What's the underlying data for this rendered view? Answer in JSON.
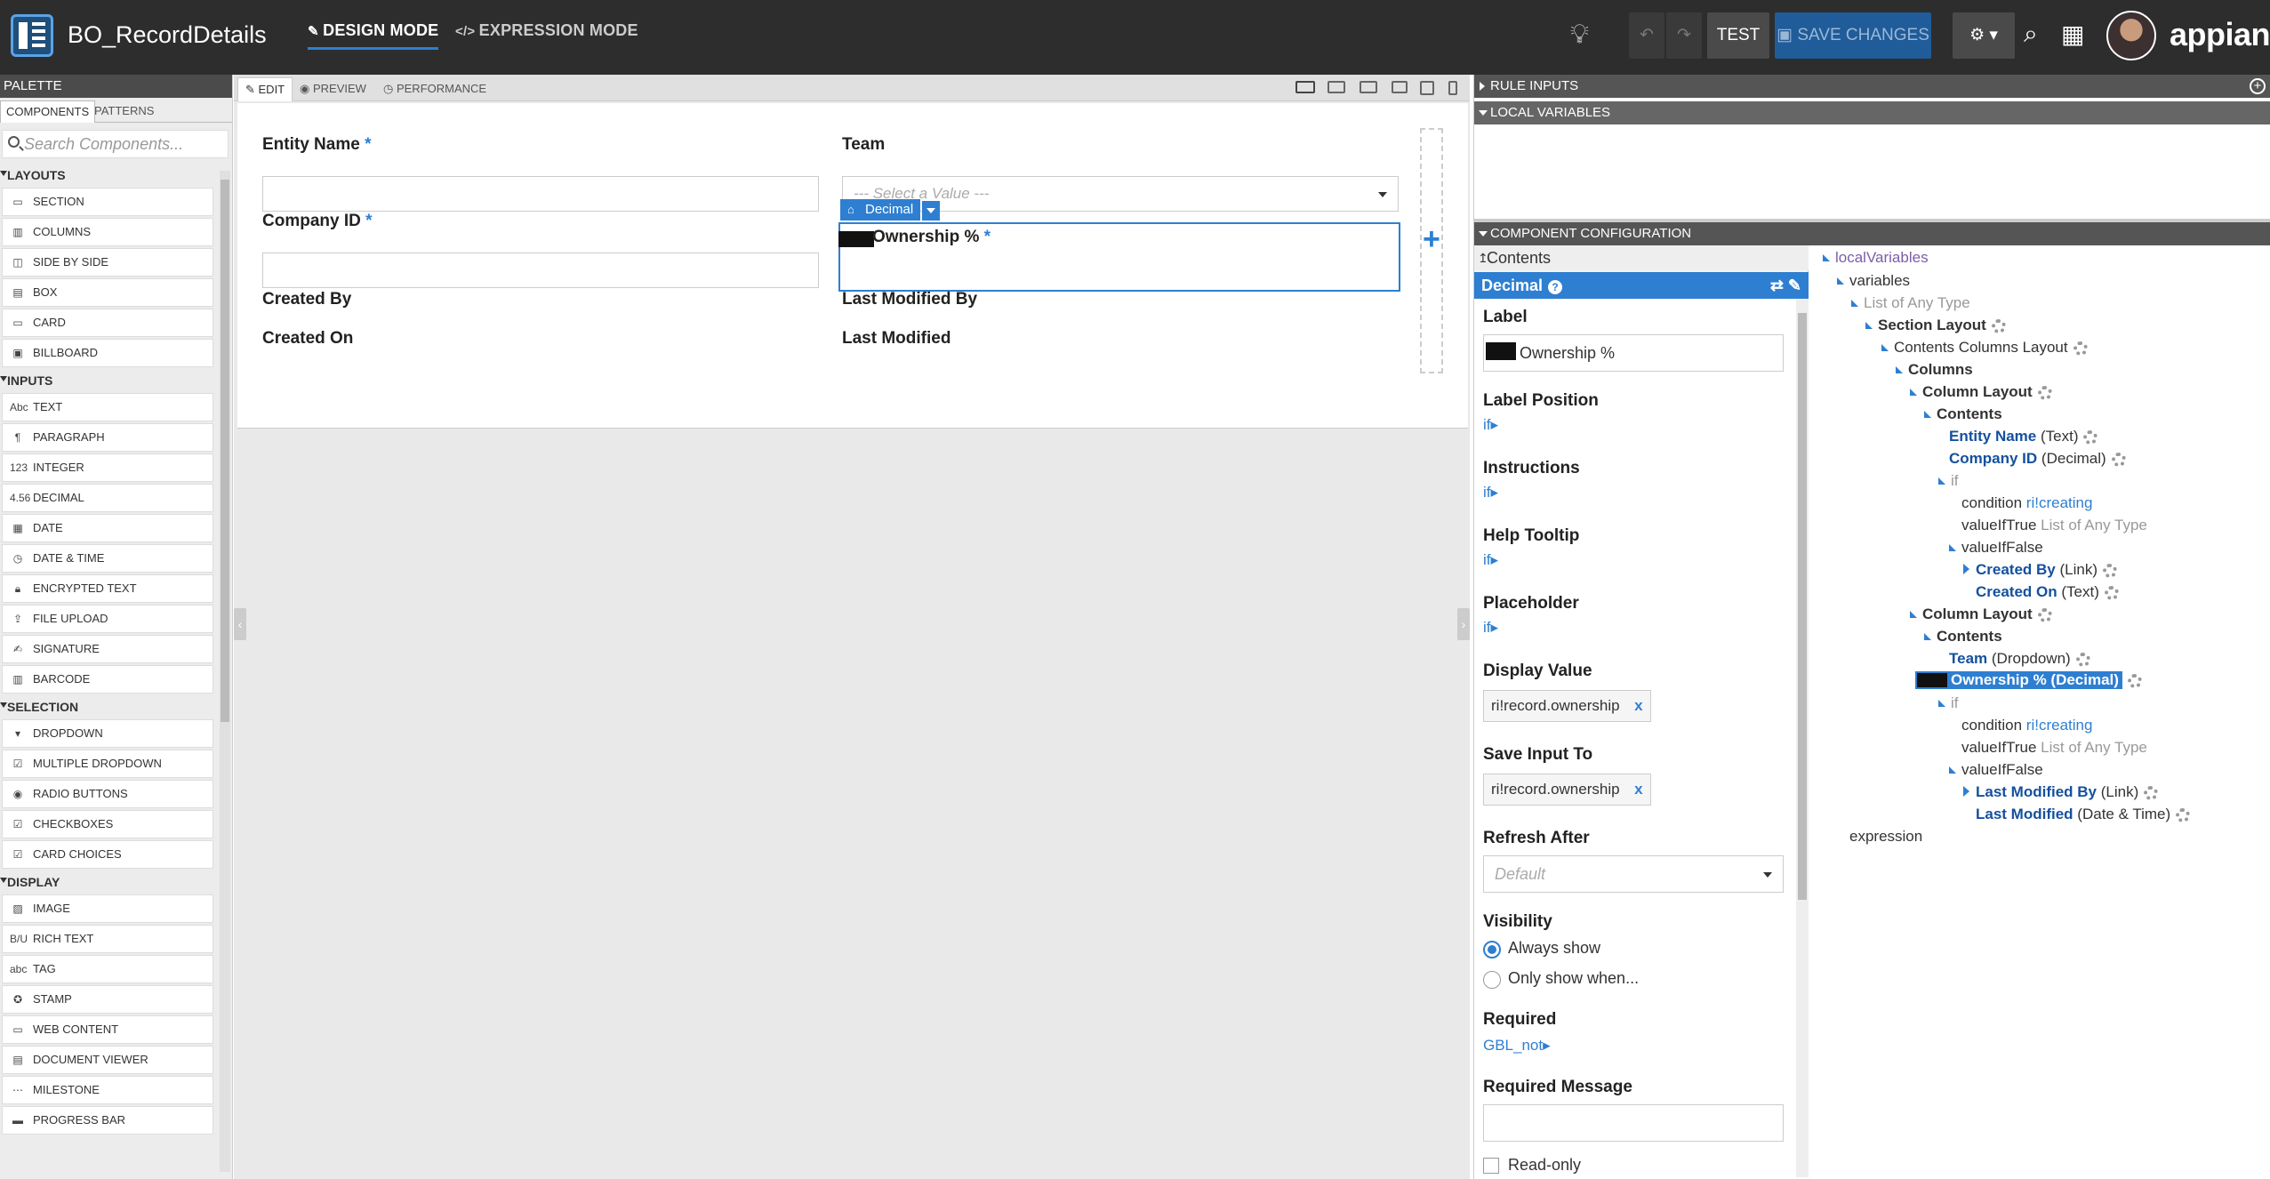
{
  "topbar": {
    "title": "BO_RecordDetails",
    "design_mode": "DESIGN MODE",
    "expression_mode": "EXPRESSION MODE",
    "test_label": "TEST",
    "save_label": "SAVE CHANGES",
    "brand": "appian"
  },
  "palette": {
    "header": "PALETTE",
    "tab_components": "COMPONENTS",
    "tab_patterns": "PATTERNS",
    "search_placeholder": "Search Components...",
    "categories": [
      {
        "name": "LAYOUTS",
        "items": [
          "SECTION",
          "COLUMNS",
          "SIDE BY SIDE",
          "BOX",
          "CARD",
          "BILLBOARD"
        ]
      },
      {
        "name": "INPUTS",
        "items": [
          "TEXT",
          "PARAGRAPH",
          "INTEGER",
          "DECIMAL",
          "DATE",
          "DATE & TIME",
          "ENCRYPTED TEXT",
          "FILE UPLOAD",
          "SIGNATURE",
          "BARCODE"
        ]
      },
      {
        "name": "SELECTION",
        "items": [
          "DROPDOWN",
          "MULTIPLE DROPDOWN",
          "RADIO BUTTONS",
          "CHECKBOXES",
          "CARD CHOICES"
        ]
      },
      {
        "name": "DISPLAY",
        "items": [
          "IMAGE",
          "RICH TEXT",
          "TAG",
          "STAMP",
          "WEB CONTENT",
          "DOCUMENT VIEWER",
          "MILESTONE",
          "PROGRESS BAR"
        ]
      }
    ]
  },
  "editor": {
    "tab_edit": "EDIT",
    "tab_preview": "PREVIEW",
    "tab_performance": "PERFORMANCE",
    "form": {
      "entity_name": "Entity Name",
      "team": "Team",
      "team_placeholder": "--- Select a Value ---",
      "company_id": "Company ID",
      "ownership": "Ownership %",
      "created_by": "Created By",
      "last_modified_by": "Last Modified By",
      "created_on": "Created On",
      "last_modified": "Last Modified",
      "required_mark": "*",
      "selected_tag": "Decimal",
      "add_column": "+"
    }
  },
  "right_panel": {
    "rule_inputs": "RULE INPUTS",
    "local_variables": "LOCAL VARIABLES",
    "component_configuration": "COMPONENT CONFIGURATION",
    "crumb": "Contents",
    "component_name": "Decimal",
    "config": {
      "label_title": "Label",
      "label_value": "Ownership %",
      "label_position": "Label Position",
      "instructions": "Instructions",
      "help_tooltip": "Help Tooltip",
      "placeholder": "Placeholder",
      "if_link": "if",
      "display_value": "Display Value",
      "display_value_pill": "ri!record.ownership",
      "save_input_to": "Save Input To",
      "save_input_pill": "ri!record.ownership",
      "pill_remove": "x",
      "refresh_after": "Refresh After",
      "refresh_default": "Default",
      "visibility": "Visibility",
      "always_show": "Always show",
      "only_show_when": "Only show when...",
      "required": "Required",
      "required_value": "GBL_not",
      "required_message": "Required Message",
      "read_only": "Read-only"
    },
    "tree": {
      "local_variables": "localVariables",
      "variables": "variables",
      "list_any_type": "List of Any Type",
      "section_layout": "Section Layout",
      "contents_columns_layout": "Contents Columns Layout",
      "columns": "Columns",
      "column_layout": "Column Layout",
      "contents": "Contents",
      "entity_name": "Entity Name",
      "entity_name_type": "(Text)",
      "company_id": "Company ID",
      "company_id_type": "(Decimal)",
      "if": "if",
      "condition": "condition",
      "ri_creating": "ri!creating",
      "value_if_true": "valueIfTrue",
      "value_if_false": "valueIfFalse",
      "created_by": "Created By",
      "created_by_type": "(Link)",
      "created_on": "Created On",
      "created_on_type": "(Text)",
      "team": "Team",
      "team_type": "(Dropdown)",
      "ownership_selected": "Ownership % (Decimal)",
      "last_modified_by": "Last Modified By",
      "last_modified_by_type": "(Link)",
      "last_modified": "Last Modified",
      "last_modified_type": "(Date & Time)",
      "expression": "expression"
    }
  },
  "colors": {
    "accent": "#2e7fd1",
    "topbar": "#2d2d2d",
    "save_button": "#1f5c99"
  }
}
